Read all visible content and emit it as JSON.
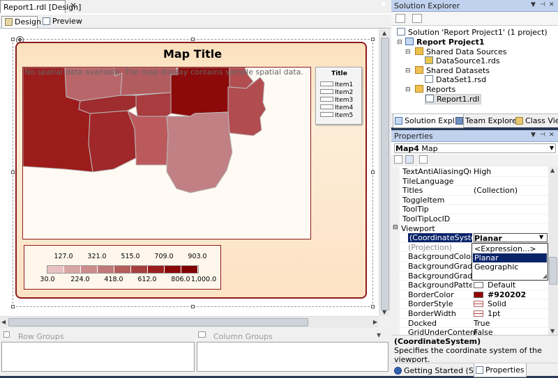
{
  "document": {
    "tab_title": "Report1.rdl [Design]",
    "view_tabs": {
      "design": "Design",
      "preview": "Preview"
    }
  },
  "map": {
    "title": "Map Title",
    "no_data_message": "No spatial data available. The map display contains sample spatial data.",
    "legend": {
      "title": "Title",
      "items": [
        "Item1",
        "Item2",
        "Item3",
        "Item4",
        "Item5"
      ]
    },
    "color_scale": {
      "top_ticks": [
        "127.0",
        "321.0",
        "515.0",
        "709.0",
        "903.0"
      ],
      "bottom_ticks": [
        "30.0",
        "224.0",
        "418.0",
        "612.0",
        "806.0",
        "1,000.0"
      ],
      "colors": [
        "#e8c2c2",
        "#d9a6a6",
        "#cc8c8c",
        "#c07878",
        "#b35c5c",
        "#a64040",
        "#991f1f",
        "#8a0a0a",
        "#800000"
      ]
    }
  },
  "groups": {
    "row_groups": "Row Groups",
    "column_groups": "Column Groups"
  },
  "solution_explorer": {
    "title": "Solution Explorer",
    "solution": "Solution 'Report Project1' (1 project)",
    "project": "Report Project1",
    "items": [
      "Shared Data Sources",
      "DataSource1.rds",
      "Shared Datasets",
      "DataSet1.rsd",
      "Reports",
      "Report1.rdl"
    ],
    "tabs": [
      "Solution Expl...",
      "Team Explorer",
      "Class View"
    ]
  },
  "properties": {
    "title": "Properties",
    "selected_object": "Map4",
    "selected_type": "Map",
    "rows": [
      {
        "name": "TextAntiAliasingQuality",
        "value": "High"
      },
      {
        "name": "TileLanguage",
        "value": ""
      },
      {
        "name": "Titles",
        "value": "(Collection)"
      },
      {
        "name": "ToggleItem",
        "value": ""
      },
      {
        "name": "ToolTip",
        "value": ""
      },
      {
        "name": "ToolTipLocID",
        "value": ""
      },
      {
        "name": "Viewport",
        "value": ""
      },
      {
        "name": "(CoordinateSystem)",
        "value": "Planar"
      },
      {
        "name": "(Projection)",
        "value": ""
      },
      {
        "name": "BackgroundColor",
        "value": ""
      },
      {
        "name": "BackgroundGradientE",
        "value": ""
      },
      {
        "name": "BackgroundGradientT",
        "value": ""
      },
      {
        "name": "BackgroundPatternTy",
        "value": "Default"
      },
      {
        "name": "BorderColor",
        "value": "#920202"
      },
      {
        "name": "BorderStyle",
        "value": "Solid"
      },
      {
        "name": "BorderWidth",
        "value": "1pt"
      },
      {
        "name": "Docked",
        "value": "True"
      },
      {
        "name": "GridUnderContent",
        "value": "False"
      }
    ],
    "dropdown_options": [
      "<Expression...>",
      "Planar",
      "Geographic"
    ],
    "description_title": "(CoordinateSystem)",
    "description_text": "Specifies the coordinate system of the viewport.",
    "bottom_tabs": [
      "Getting Started (SSIS)",
      "Properties"
    ]
  },
  "colors": {
    "border_red": "#920202",
    "selection_blue": "#0a246a",
    "panel_header": "#c1d2ee"
  }
}
